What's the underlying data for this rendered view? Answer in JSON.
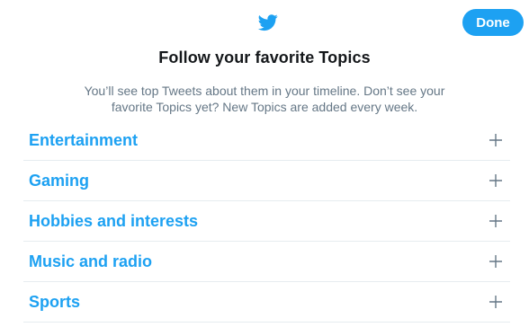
{
  "header": {
    "logo_icon": "twitter-bird-icon",
    "done_label": "Done",
    "accent_color": "#1da1f2"
  },
  "main": {
    "title": "Follow your favorite Topics",
    "subtitle": "You’ll see top Tweets about them in your timeline. Don’t see your favorite Topics yet? New Topics are added every week."
  },
  "topics": [
    {
      "label": "Entertainment",
      "icon": "plus-icon"
    },
    {
      "label": "Gaming",
      "icon": "plus-icon"
    },
    {
      "label": "Hobbies and interests",
      "icon": "plus-icon"
    },
    {
      "label": "Music and radio",
      "icon": "plus-icon"
    },
    {
      "label": "Sports",
      "icon": "plus-icon"
    }
  ]
}
